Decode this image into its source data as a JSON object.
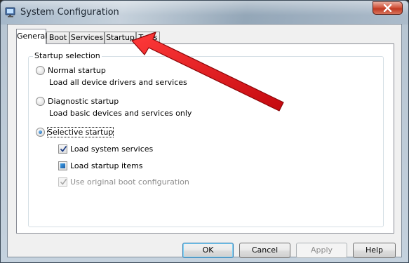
{
  "window": {
    "title": "System Configuration"
  },
  "tabs": [
    "General",
    "Boot",
    "Services",
    "Startup",
    "Tools"
  ],
  "active_tab": "General",
  "group": {
    "legend": "Startup selection"
  },
  "options": {
    "normal": {
      "label": "Normal startup",
      "description": "Load all device drivers and services",
      "selected": false
    },
    "diagnostic": {
      "label": "Diagnostic startup",
      "description": "Load basic devices and services only",
      "selected": false
    },
    "selective": {
      "label": "Selective startup",
      "selected": true
    }
  },
  "checkboxes": {
    "system_services": {
      "label": "Load system services",
      "state": "checked"
    },
    "startup_items": {
      "label": "Load startup items",
      "state": "indeterminate"
    },
    "original_boot": {
      "label": "Use original boot configuration",
      "state": "checked-disabled"
    }
  },
  "buttons": {
    "ok": "OK",
    "cancel": "Cancel",
    "apply": "Apply",
    "help": "Help"
  },
  "annotation": {
    "arrow_color": "#e8141b"
  }
}
